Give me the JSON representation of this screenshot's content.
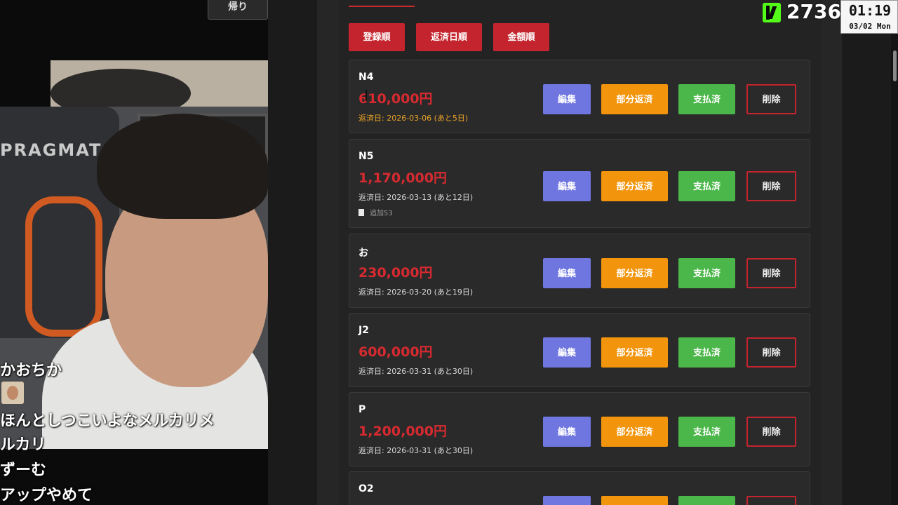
{
  "stream": {
    "top_button_label": "帰り",
    "chat": [
      {
        "text": "かおちか"
      },
      {
        "text": "ほんとしつこいよなメルカリメ"
      },
      {
        "text": "ルカリ"
      },
      {
        "text": "ずーむ"
      },
      {
        "text": "アップやめて"
      }
    ],
    "chair_brand": "PRAGMATA"
  },
  "overlay": {
    "viewer_count": "2736",
    "clock_time": "01:19",
    "clock_date": "03/02 Mon",
    "brand_color": "#53fc18"
  },
  "sort_buttons": [
    "登録順",
    "返済日順",
    "金額順"
  ],
  "actions": {
    "edit": "編集",
    "partial": "部分返済",
    "paid": "支払済",
    "delete": "削除"
  },
  "loans": [
    {
      "name": "N4",
      "amount": "610,000円",
      "due": "返済日: 2026-03-06 (あと5日)",
      "urgent": true,
      "note": ""
    },
    {
      "name": "N5",
      "amount": "1,170,000円",
      "due": "返済日: 2026-03-13 (あと12日)",
      "urgent": false,
      "note": "追加53"
    },
    {
      "name": "お",
      "amount": "230,000円",
      "due": "返済日: 2026-03-20 (あと19日)",
      "urgent": false,
      "note": ""
    },
    {
      "name": "J2",
      "amount": "600,000円",
      "due": "返済日: 2026-03-31 (あと30日)",
      "urgent": false,
      "note": ""
    },
    {
      "name": "P",
      "amount": "1,200,000円",
      "due": "返済日: 2026-03-31 (あと30日)",
      "urgent": false,
      "note": ""
    },
    {
      "name": "O2",
      "amount": "",
      "due": "",
      "urgent": false,
      "note": ""
    }
  ],
  "colors": {
    "accent_red": "#c3242d",
    "amount_red": "#d62a30",
    "edit_blue": "#6f76e0",
    "partial_orange": "#f2950c",
    "paid_green": "#4bb649",
    "urgent_orange": "#e8a127"
  }
}
